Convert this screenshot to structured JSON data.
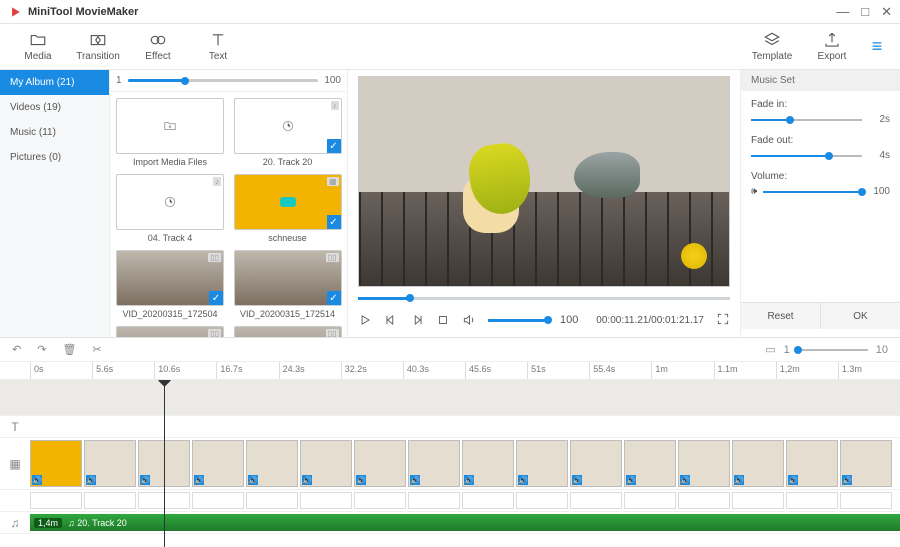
{
  "app": {
    "title": "MiniTool MovieMaker"
  },
  "toolbar": {
    "media": "Media",
    "transition": "Transition",
    "effect": "Effect",
    "text": "Text",
    "template": "Template",
    "export": "Export"
  },
  "sidebar": {
    "items": [
      {
        "label": "My Album",
        "count": "(21)",
        "active": true
      },
      {
        "label": "Videos",
        "count": "(19)",
        "active": false
      },
      {
        "label": "Music",
        "count": "(11)",
        "active": false
      },
      {
        "label": "Pictures",
        "count": "(0)",
        "active": false
      }
    ]
  },
  "mediaPanel": {
    "thumbMin": "1",
    "thumbMax": "100",
    "items": [
      {
        "label": "Import Media Files",
        "kind": "import"
      },
      {
        "label": "20. Track 20",
        "kind": "audio",
        "checked": true
      },
      {
        "label": "04. Track 4",
        "kind": "audio"
      },
      {
        "label": "schneuse",
        "kind": "image",
        "checked": true
      },
      {
        "label": "VID_20200315_172504",
        "kind": "video",
        "checked": true
      },
      {
        "label": "VID_20200315_172514",
        "kind": "video",
        "checked": true
      },
      {
        "label": "",
        "kind": "video"
      },
      {
        "label": "",
        "kind": "video"
      }
    ]
  },
  "preview": {
    "volume": "100",
    "time": "00:00:11.21/00:01:21.17"
  },
  "musicSet": {
    "title": "Music Set",
    "fadeInLabel": "Fade in:",
    "fadeInVal": "2s",
    "fadeInPct": 35,
    "fadeOutLabel": "Fade out:",
    "fadeOutVal": "4s",
    "fadeOutPct": 70,
    "volumeLabel": "Volume:",
    "volumeVal": "100",
    "volumePct": 100,
    "reset": "Reset",
    "ok": "OK"
  },
  "timeline": {
    "zoomMin": "1",
    "zoomMax": "10",
    "ticks": [
      "0s",
      "5.6s",
      "10.6s",
      "16.7s",
      "24.3s",
      "32.2s",
      "40.3s",
      "45.6s",
      "51s",
      "55.4s",
      "1m",
      "1.1m",
      "1,2m",
      "1.3m"
    ],
    "musicClip": {
      "duration": "1,4m",
      "label": "♫ 20. Track 20"
    }
  }
}
